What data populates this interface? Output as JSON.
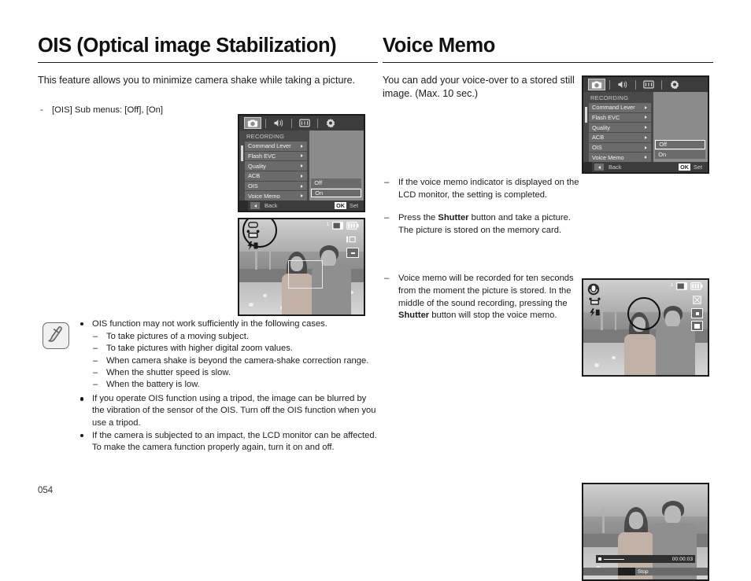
{
  "page": {
    "number": "054"
  },
  "left": {
    "title": "OIS (Optical image Stabilization)",
    "intro": "This feature allows you to minimize camera shake while taking a picture.",
    "submenu_dash": "-",
    "submenu_line": "[OIS] Sub menus: [Off], [On]",
    "menu": {
      "tabs": [
        "camera-icon",
        "sound-icon",
        "display-icon",
        "settings-icon"
      ],
      "title": "RECORDING",
      "items": [
        {
          "label": "Command Lever"
        },
        {
          "label": "Flash EVC"
        },
        {
          "label": "Quality"
        },
        {
          "label": "ACB"
        },
        {
          "label": "OIS"
        },
        {
          "label": "Voice Memo"
        }
      ],
      "submenu": [
        {
          "label": "Off",
          "selected": false
        },
        {
          "label": "On",
          "selected": true
        }
      ],
      "footer": {
        "back": "Back",
        "ok": "OK",
        "set": "Set"
      }
    },
    "preview": {
      "counter": "1",
      "icons": [
        "memory-card-icon",
        "battery-icon",
        "hand-shake-icon",
        "flash-icon"
      ],
      "left_icons": [
        "ois-icon",
        "anti-shake-icon",
        "flash-off-icon"
      ]
    },
    "note": {
      "icon": "note-pencil-icon",
      "bullets": [
        {
          "text": "OIS function may not work sufficiently in the following cases.",
          "sub": [
            "To take pictures of a moving subject.",
            "To take pictures with higher digital zoom values.",
            "When camera shake is beyond the camera-shake correction range.",
            "When the shutter speed is slow.",
            "When the battery is low."
          ]
        },
        {
          "text": "If you operate OIS function using a tripod, the image can be blurred by the vibration of the sensor of the OIS. Turn off the OIS function when you use a tripod.",
          "sub": []
        },
        {
          "text": "If the camera is subjected to an impact, the LCD monitor can be affected. To make the camera function properly again, turn it on and off.",
          "sub": []
        }
      ],
      "sub_dash": "–"
    }
  },
  "right": {
    "title": "Voice Memo",
    "intro": "You can add your voice-over to a stored still image. (Max. 10 sec.)",
    "menu": {
      "tabs": [
        "camera-icon",
        "sound-icon",
        "display-icon",
        "settings-icon"
      ],
      "title": "RECORDING",
      "items": [
        {
          "label": "Command Lever"
        },
        {
          "label": "Flash EVC"
        },
        {
          "label": "Quality"
        },
        {
          "label": "ACB"
        },
        {
          "label": "OIS"
        },
        {
          "label": "Voice Memo"
        }
      ],
      "submenu": [
        {
          "label": "Off",
          "selected": true
        },
        {
          "label": "On",
          "selected": false
        }
      ],
      "footer": {
        "back": "Back",
        "ok": "OK",
        "set": "Set"
      }
    },
    "bullets": [
      {
        "dash": "–",
        "pre": "If the voice memo indicator is displayed on the LCD monitor, the setting is completed.",
        "bold": "",
        "post": ""
      },
      {
        "dash": "–",
        "pre": "Press the ",
        "bold": "Shutter",
        "post": " button and take a picture. The picture is stored on the memory card."
      },
      {
        "dash": "–",
        "pre": "Voice memo will be recorded for ten seconds from the moment the picture is stored. In the middle of the sound recording, pressing the ",
        "bold": "Shutter",
        "post": " button will stop the voice memo."
      }
    ],
    "preview": {
      "counter": "1",
      "voice_memo_indicator": "voice-memo-icon"
    },
    "playback": {
      "time": "00:00:03",
      "stop_label": "Stop",
      "record_icon": "record-dot-icon"
    }
  }
}
